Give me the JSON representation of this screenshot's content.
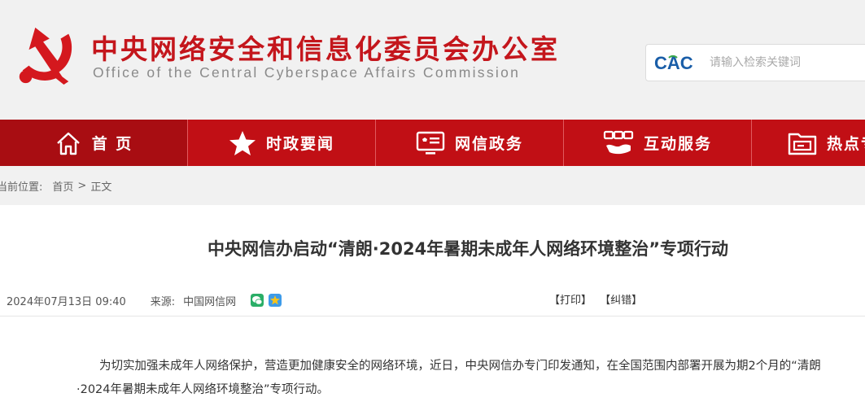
{
  "header": {
    "org_name_cn": "中央网络安全和信息化委员会办公室",
    "org_name_en": "Office of the Central Cyberspace Affairs Commission",
    "logo_text": "CAC",
    "search_placeholder": "请输入检索关键词"
  },
  "nav": {
    "items": [
      {
        "label": "首 页",
        "icon": "home-icon"
      },
      {
        "label": "时政要闻",
        "icon": "star-icon"
      },
      {
        "label": "网信政务",
        "icon": "monitor-icon"
      },
      {
        "label": "互动服务",
        "icon": "handshake-icon"
      },
      {
        "label": "热点专",
        "icon": "folder-icon"
      }
    ]
  },
  "breadcrumb": {
    "prefix": "当前位置:",
    "home": "首页",
    "separator": ">",
    "current": "正文"
  },
  "article": {
    "title": "中央网信办启动“清朗·2024年暑期未成年人网络环境整治”专项行动",
    "date": "2024年07月13日 09:40",
    "source_label": "来源:",
    "source": "中国网信网",
    "print_label": "【打印】",
    "error_label": "【纠错】",
    "paragraph": "为切实加强未成年人网络保护，营造更加健康安全的网络环境，近日，中央网信办专门印发通知，在全国范围内部署开展为期2个月的“清朗·2024年暑期未成年人网络环境整治”专项行动。"
  },
  "colors": {
    "brand_red": "#c10f15",
    "header_bg": "#f1f1f1"
  }
}
